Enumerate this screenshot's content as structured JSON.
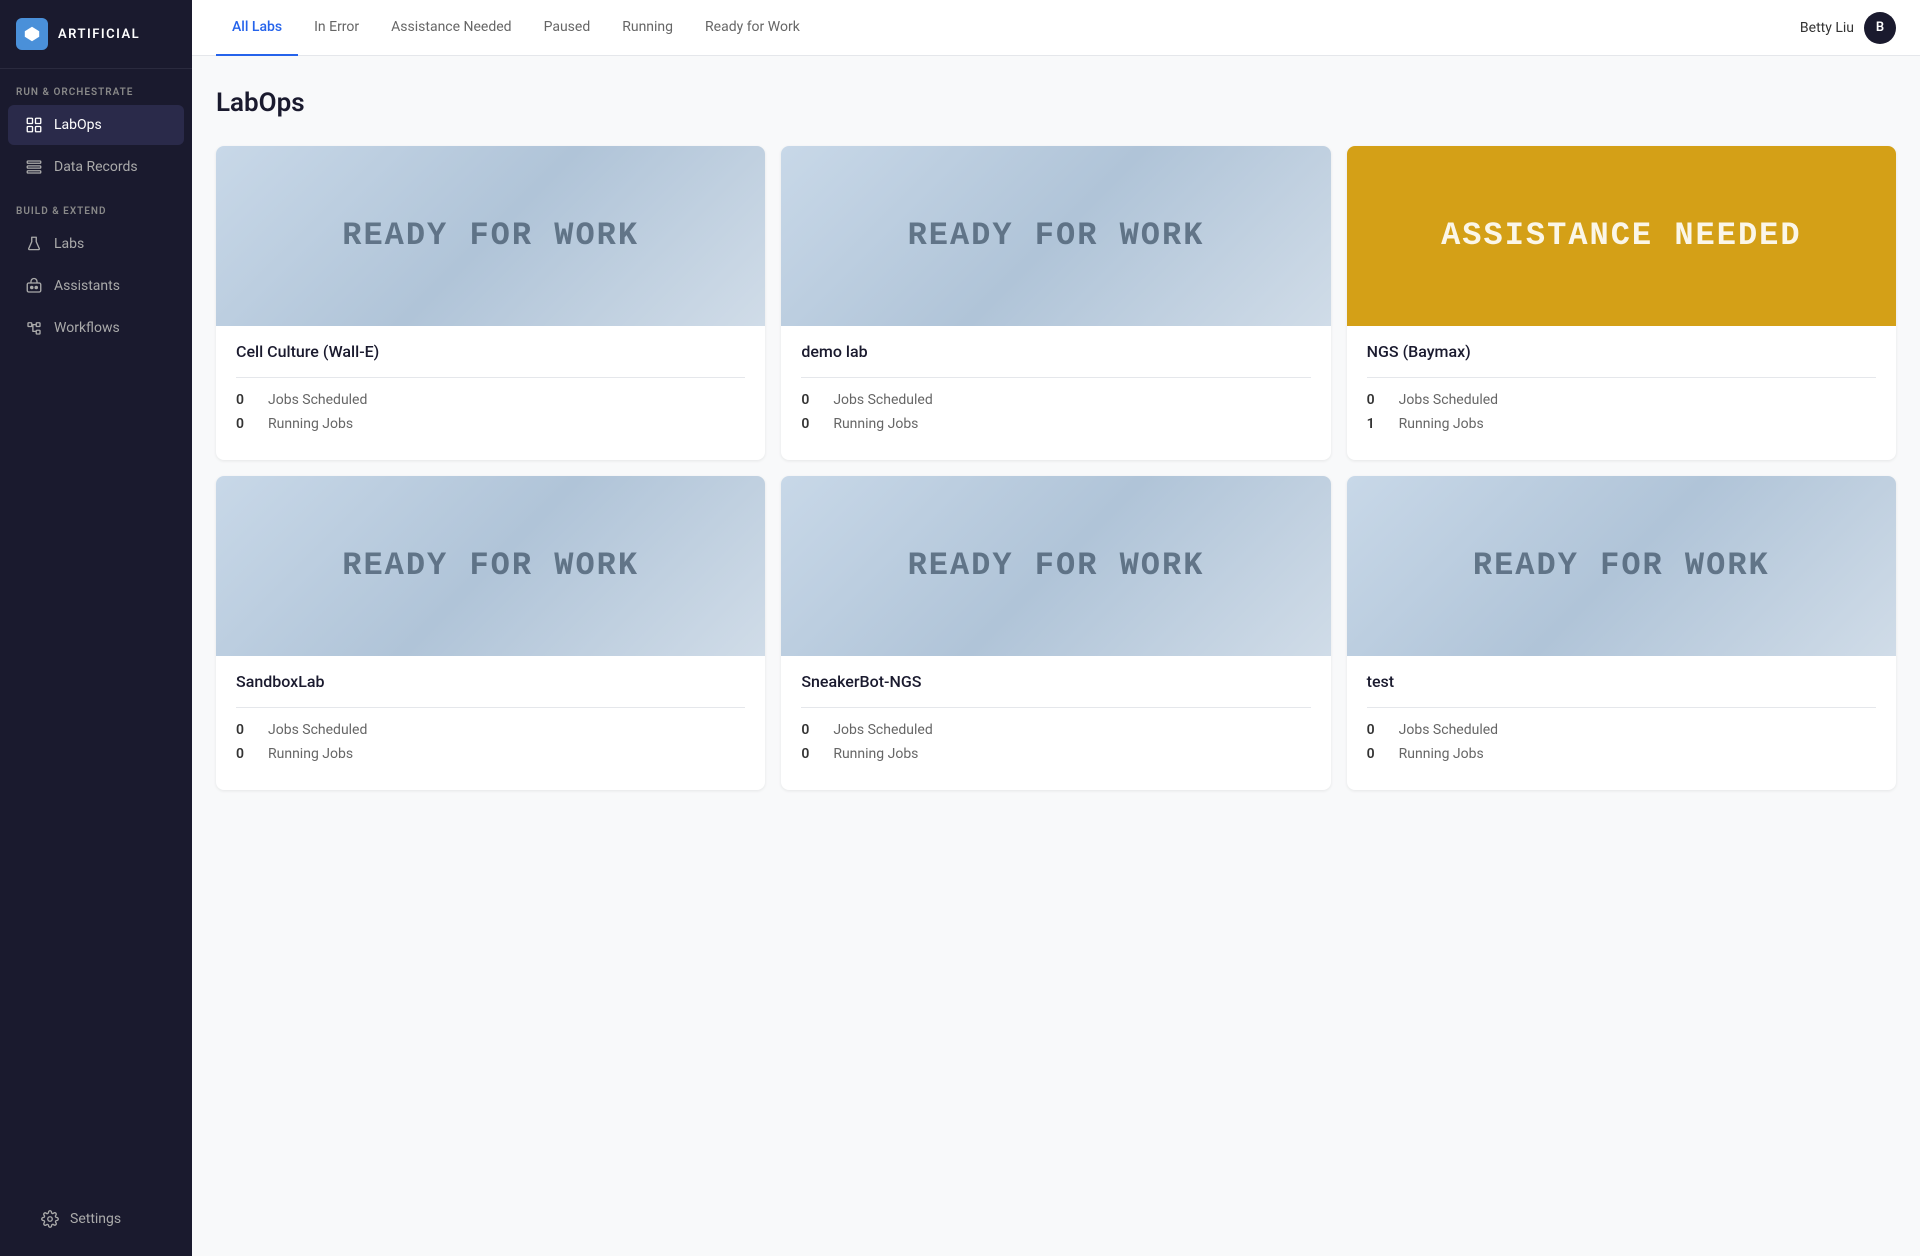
{
  "sidebar": {
    "logo": {
      "icon": "A",
      "text": "ARTIFICIAL"
    },
    "sections": [
      {
        "label": "RUN & ORCHESTRATE",
        "items": [
          {
            "id": "labops",
            "label": "LabOps",
            "icon": "grid",
            "active": true
          },
          {
            "id": "data-records",
            "label": "Data Records",
            "icon": "list"
          }
        ]
      },
      {
        "label": "BUILD & EXTEND",
        "items": [
          {
            "id": "labs",
            "label": "Labs",
            "icon": "flask"
          },
          {
            "id": "assistants",
            "label": "Assistants",
            "icon": "bot"
          },
          {
            "id": "workflows",
            "label": "Workflows",
            "icon": "workflow"
          }
        ]
      }
    ],
    "bottom": {
      "settings_label": "Settings"
    }
  },
  "topnav": {
    "tabs": [
      {
        "id": "all-labs",
        "label": "All Labs",
        "active": true
      },
      {
        "id": "in-error",
        "label": "In Error",
        "active": false
      },
      {
        "id": "assistance-needed",
        "label": "Assistance Needed",
        "active": false
      },
      {
        "id": "paused",
        "label": "Paused",
        "active": false
      },
      {
        "id": "running",
        "label": "Running",
        "active": false
      },
      {
        "id": "ready-for-work",
        "label": "Ready for Work",
        "active": false
      }
    ],
    "user": {
      "name": "Betty Liu",
      "avatar": "B"
    }
  },
  "page": {
    "title": "LabOps"
  },
  "labs": [
    {
      "id": "cell-culture",
      "name": "Cell Culture (Wall-E)",
      "status": "READY FOR WORK",
      "status_type": "ready-for-work",
      "jobs_scheduled": 0,
      "running_jobs": 0
    },
    {
      "id": "demo-lab",
      "name": "demo lab",
      "status": "READY FOR WORK",
      "status_type": "ready-for-work",
      "jobs_scheduled": 0,
      "running_jobs": 0
    },
    {
      "id": "ngs-baymax",
      "name": "NGS (Baymax)",
      "status": "ASSISTANCE NEEDED",
      "status_type": "assistance-needed",
      "jobs_scheduled": 0,
      "running_jobs": 1
    },
    {
      "id": "sandbox-lab",
      "name": "SandboxLab",
      "status": "READY FOR WORK",
      "status_type": "ready-for-work",
      "jobs_scheduled": 0,
      "running_jobs": 0
    },
    {
      "id": "sneakerbot-ngs",
      "name": "SneakerBot-NGS",
      "status": "READY FOR WORK",
      "status_type": "ready-for-work",
      "jobs_scheduled": 0,
      "running_jobs": 0
    },
    {
      "id": "test",
      "name": "test",
      "status": "READY FOR WORK",
      "status_type": "ready-for-work",
      "jobs_scheduled": 0,
      "running_jobs": 0
    }
  ],
  "labels": {
    "jobs_scheduled": "Jobs Scheduled",
    "running_jobs": "Running Jobs"
  }
}
